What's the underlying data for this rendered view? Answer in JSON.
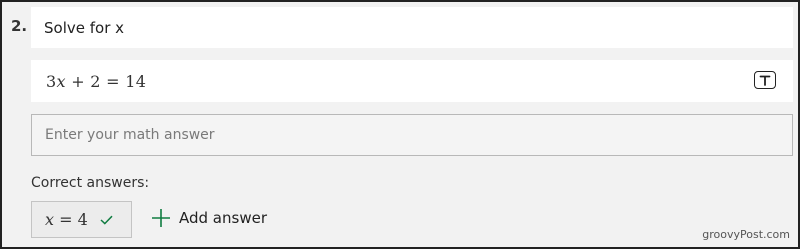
{
  "question": {
    "number": "2.",
    "title": "Solve for x"
  },
  "equation": {
    "coef": "3",
    "var": "x",
    "rest": " + 2 = 14"
  },
  "text_toggle_icon": "text-format-icon",
  "answer_input": {
    "placeholder": "Enter your math answer"
  },
  "correct_answers": {
    "label": "Correct answers:",
    "items": [
      {
        "var": "x",
        "rest": " = 4",
        "status_icon": "check-icon"
      }
    ]
  },
  "add_answer": {
    "label": "Add answer",
    "icon": "plus-icon"
  },
  "colors": {
    "accent_green": "#107c41"
  },
  "watermark": "groovyPost.com"
}
